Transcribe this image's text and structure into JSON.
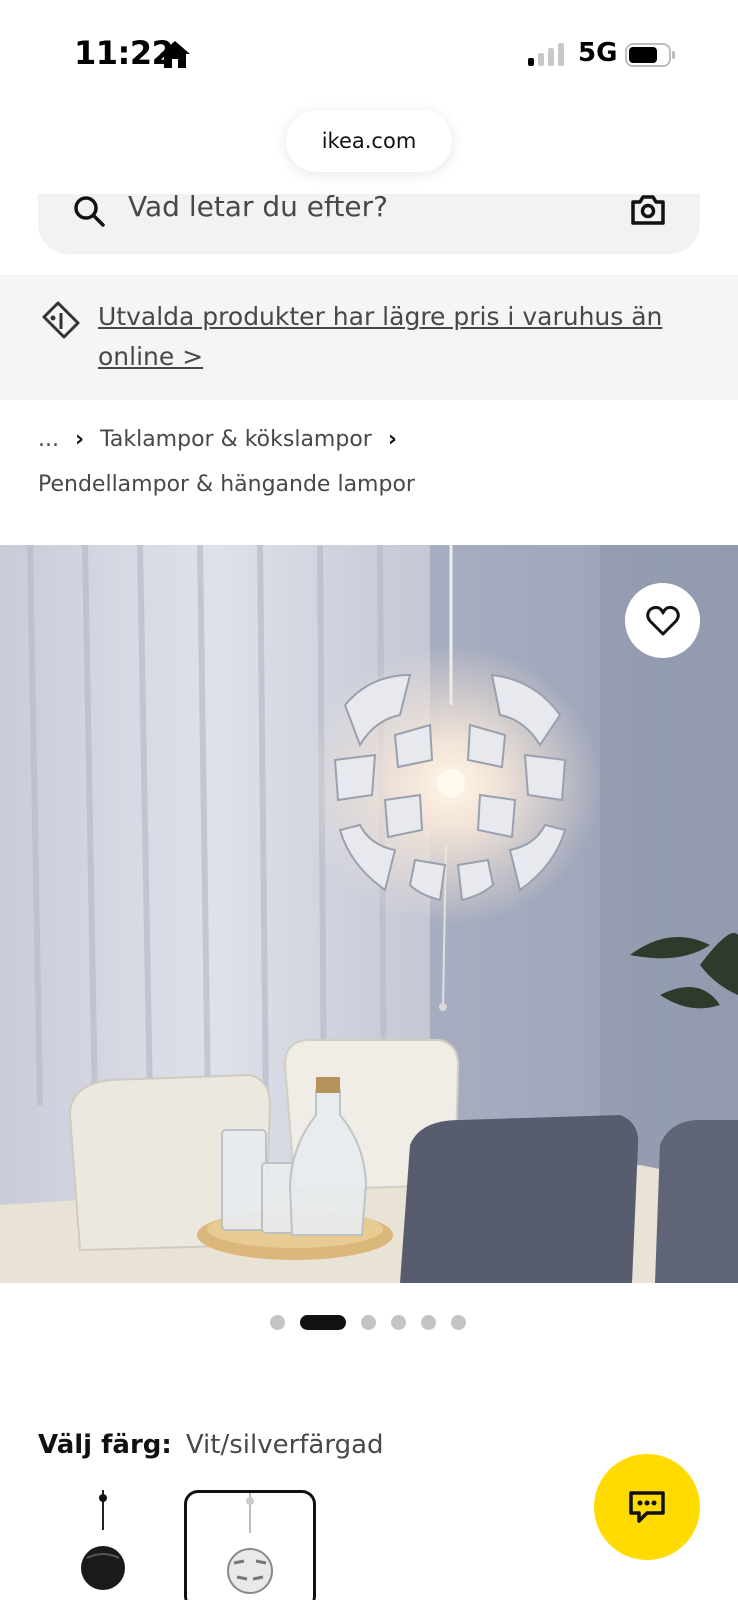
{
  "status_bar": {
    "time": "11:22",
    "network": "5G"
  },
  "browser": {
    "url": "ikea.com"
  },
  "search": {
    "placeholder": "Vad letar du efter?"
  },
  "promo": {
    "text": "Utvalda produkter har lägre pris i varuhus än online >"
  },
  "breadcrumb": {
    "ellipsis": "...",
    "parent": "Taklampor & kökslampor",
    "current": "Pendellampor & hängande lampor"
  },
  "gallery": {
    "image_count": 6,
    "active_index": 1
  },
  "color_select": {
    "label": "Välj färg:",
    "value": "Vit/silverfärgad",
    "options": [
      "black",
      "white-silver"
    ],
    "selected_index": 1
  },
  "colors": {
    "brand_yellow": "#ffdb00",
    "text_dark": "#111111",
    "text_muted": "#484848",
    "banner_bg": "#f5f5f5"
  }
}
